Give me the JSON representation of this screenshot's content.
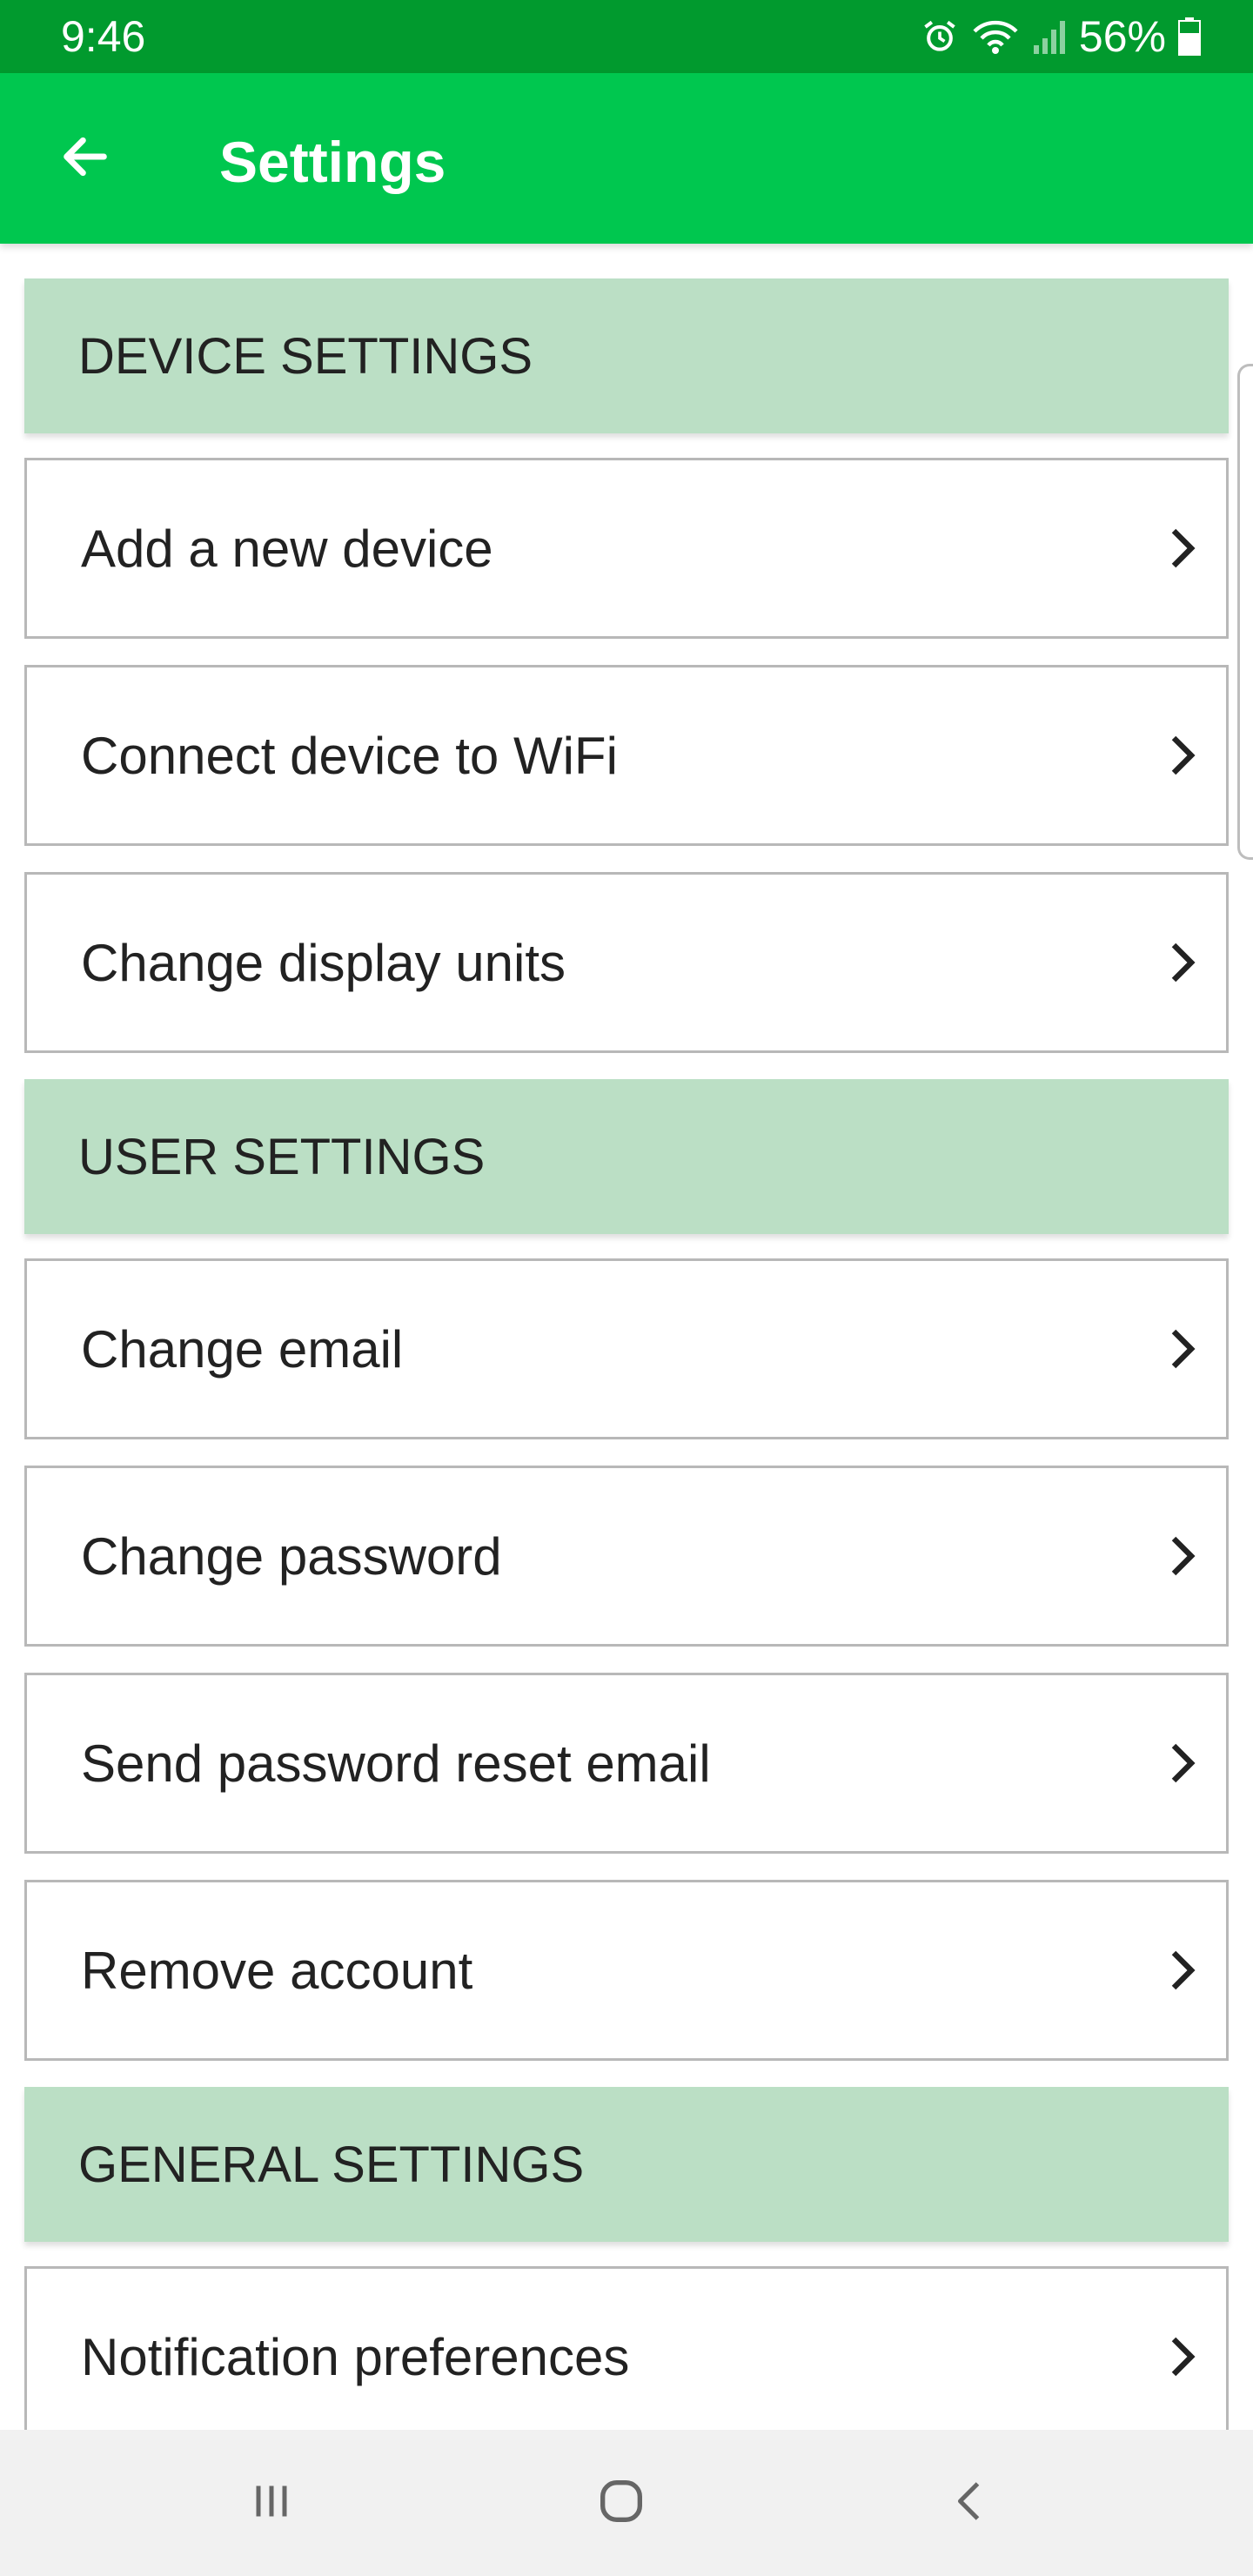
{
  "status_bar": {
    "time": "9:46",
    "battery": "56%",
    "icons": [
      "alarm-icon",
      "wifi-icon",
      "signal-icon",
      "battery-icon"
    ]
  },
  "header": {
    "title": "Settings",
    "back_icon": "arrow-back-icon"
  },
  "sections": [
    {
      "title": "DEVICE SETTINGS",
      "items": [
        {
          "label": "Add a new device"
        },
        {
          "label": "Connect device to WiFi"
        },
        {
          "label": "Change display units"
        }
      ]
    },
    {
      "title": "USER SETTINGS",
      "items": [
        {
          "label": "Change email"
        },
        {
          "label": "Change password"
        },
        {
          "label": "Send password reset email"
        },
        {
          "label": "Remove account"
        }
      ]
    },
    {
      "title": "GENERAL SETTINGS",
      "items": [
        {
          "label": "Notification preferences"
        }
      ]
    }
  ],
  "nav_bar": {
    "icons": [
      "recent-apps-icon",
      "home-icon",
      "back-nav-icon"
    ]
  },
  "colors": {
    "status_bar": "#019A2E",
    "app_bar": "#00C74F",
    "section_header": "#BBDFC5",
    "item_border": "#B8B8B8",
    "nav_bar": "#F1F1F1"
  }
}
